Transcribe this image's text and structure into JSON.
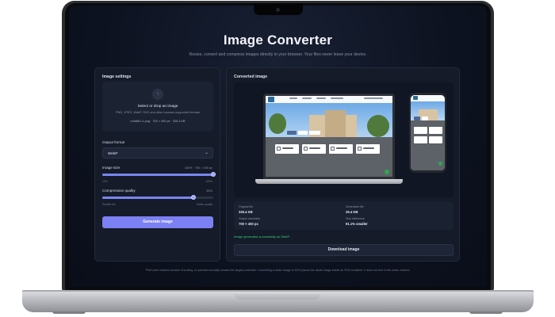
{
  "header": {
    "title": "Image Converter",
    "subtitle": "Resize, convert and compress images directly in your browser. Your files never leave your device."
  },
  "settings": {
    "heading": "Image settings",
    "dropzone": {
      "title": "Select or drop an image",
      "subtitle": "PNG, JPEG, WebP, SVG and other browser-supported formats",
      "file_info": "m4a8e1-1.png · 700 × 400 px · 326.4 KB"
    },
    "output_format": {
      "label": "Output format",
      "value": "WebP"
    },
    "image_size": {
      "label": "Image size",
      "value_text": "100% · 700 × 400 px",
      "min_label": "10%",
      "max_label": "100%",
      "fraction": 1.0
    },
    "compression": {
      "label": "Compression quality",
      "value_text": "82%",
      "min_label": "Smaller file",
      "max_label": "Better quality",
      "fraction": 0.82
    },
    "generate_label": "Generate image"
  },
  "result": {
    "heading": "Converted image",
    "stats": [
      {
        "label": "Original file",
        "value": "326.4 KB"
      },
      {
        "label": "Generated file",
        "value": "29.4 KB"
      },
      {
        "label": "Output resolution",
        "value": "700 × 400 px"
      },
      {
        "label": "Size difference",
        "value": "91.1% smaller"
      }
    ],
    "success_message": "Image generated successfully as WebP.",
    "download_label": "Download image"
  },
  "footer_note": "PNG uses lossless browser encoding, so preview normally creates the largest collection. Converting a raster image to SVG places the raster image inside an SVG container. It does not turn it into vector artwork.",
  "colors": {
    "accent": "#7b80f2",
    "success": "#34d27a",
    "panel": "#151b29",
    "background": "#0d1220"
  },
  "icons": [
    "upload-icon",
    "chevron-down-icon",
    "chat-icon"
  ]
}
